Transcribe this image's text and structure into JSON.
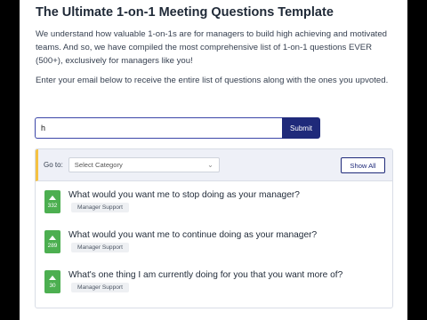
{
  "title": "The Ultimate 1-on-1 Meeting Questions Template",
  "intro": "We understand how valuable 1-on-1s are for managers to build high achieving and motivated teams. And so, we have compiled the most comprehensive list of 1-on-1 questions EVER (500+), exclusively for managers like you!",
  "prompt": "Enter your email below to receive the entire list of questions along with the ones you upvoted.",
  "email_form": {
    "value": "h",
    "submit_label": "Submit"
  },
  "filter_bar": {
    "goto_label": "Go to:",
    "category_selected": "Select Category",
    "show_all_label": "Show All"
  },
  "questions": [
    {
      "votes": "332",
      "text": "What would you want me to stop doing as your manager?",
      "tag": "Manager Support"
    },
    {
      "votes": "289",
      "text": "What would you want me to continue doing as your manager?",
      "tag": "Manager Support"
    },
    {
      "votes": "30",
      "text": "What's one thing I am currently doing for you that you want more of?",
      "tag": "Manager Support"
    }
  ],
  "colors": {
    "brand": "#1f2a7a",
    "upvote": "#4caf50",
    "goto_accent": "#f5c242"
  }
}
